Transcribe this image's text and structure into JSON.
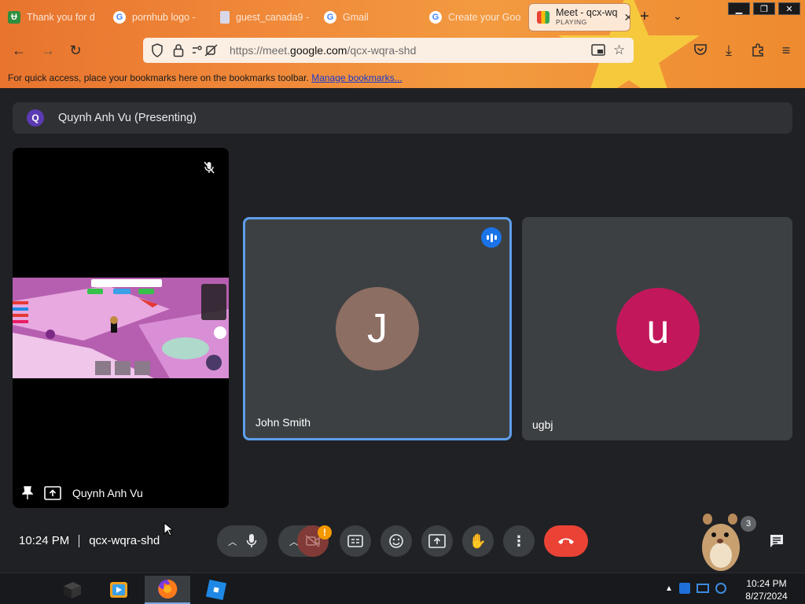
{
  "browser": {
    "tabs": [
      {
        "label": "Thank you for d",
        "icon": "green-leaf-icon"
      },
      {
        "label": "pornhub logo -",
        "icon": "google-g-icon"
      },
      {
        "label": "guest_canada9 -",
        "icon": "document-icon"
      },
      {
        "label": "Gmail",
        "icon": "google-g-icon"
      },
      {
        "label": "Create your Goo",
        "icon": "google-g-icon"
      },
      {
        "label": "Meet - qcx-wq",
        "sub": "PLAYING",
        "icon": "meet-icon",
        "active": true
      }
    ],
    "url_prefix": "https://meet.",
    "url_domain": "google.com",
    "url_path": "/qcx-wqra-shd",
    "bookmarks_text": "For quick access, place your bookmarks here on the bookmarks toolbar.",
    "bookmarks_link": "Manage bookmarks..."
  },
  "meet": {
    "presenting_initial": "Q",
    "presenting_label": "Quynh Anh Vu (Presenting)",
    "presenter_name": "Quynh Anh Vu",
    "participants": [
      {
        "name": "John Smith",
        "initial": "J",
        "color": "#8d6e63",
        "speaking": true
      },
      {
        "name": "ugbj",
        "initial": "u",
        "color": "#c2185b",
        "speaking": false
      }
    ],
    "time": "10:24 PM",
    "meeting_code": "qcx-wqra-shd",
    "camera_warning": "!",
    "people_count": "3"
  },
  "taskbar": {
    "time": "10:24 PM",
    "date": "8/27/2024"
  },
  "colors": {
    "meet_bg": "#202124",
    "tile_bg": "#3c4043",
    "end_call": "#ea4335",
    "speaking_blue": "#1a73e8",
    "active_border": "#5e9eea"
  }
}
